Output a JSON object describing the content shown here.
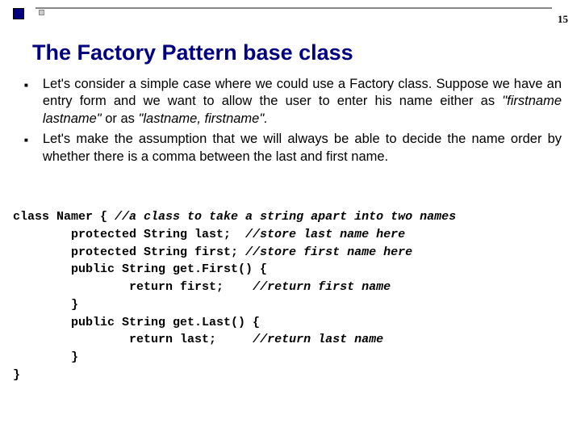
{
  "page_number": "15",
  "title": "The Factory Pattern base class",
  "bullets": [
    {
      "text_parts": [
        {
          "text": "Let's consider a simple case where we could use a Factory class. Suppose we have an entry form and we want to allow the user to enter his name either as ",
          "italic": false
        },
        {
          "text": "\"firstname lastname\"",
          "italic": true
        },
        {
          "text": " or as ",
          "italic": false
        },
        {
          "text": "\"lastname, firstname\".",
          "italic": true
        }
      ]
    },
    {
      "text_parts": [
        {
          "text": "Let's make the assumption that we will always be able to decide the name order by whether there is a comma between the last and first name.",
          "italic": false
        }
      ]
    }
  ],
  "code": {
    "line1_a": "class Namer { ",
    "line1_b": "//a class to take a string apart into two names",
    "line2_a": "        protected String last;  ",
    "line2_b": "//store last name here",
    "line3_a": "        protected String first; ",
    "line3_b": "//store first name here",
    "line4": "        public String get.First() {",
    "line5_a": "                return first;    ",
    "line5_b": "//return first name",
    "line6": "        }",
    "line7": "        public String get.Last() {",
    "line8_a": "                return last;     ",
    "line8_b": "//return last name",
    "line9": "        }",
    "line10": "}"
  }
}
